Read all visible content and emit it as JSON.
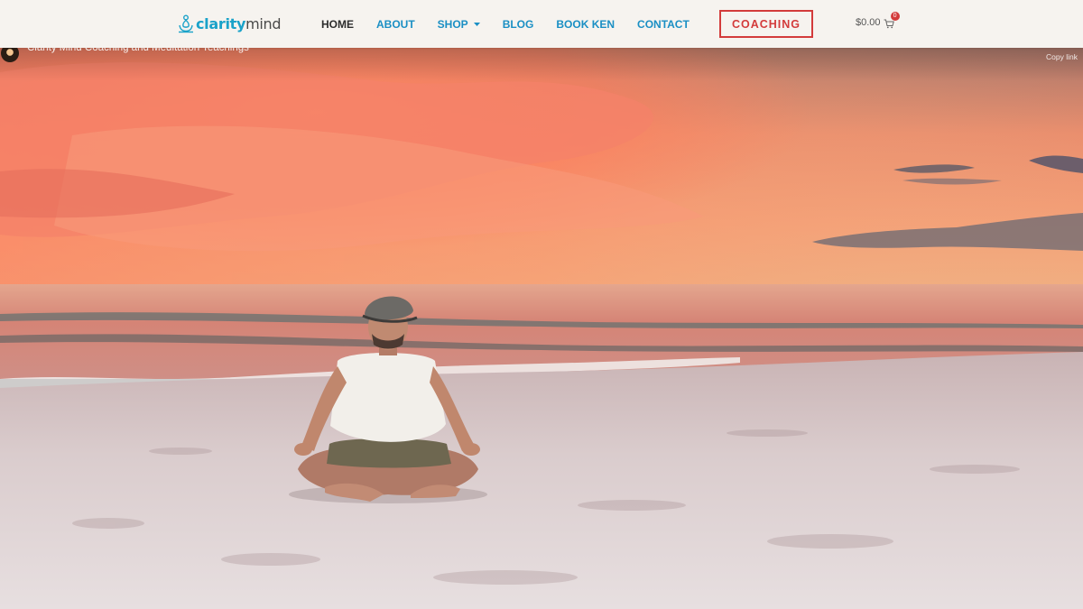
{
  "header": {
    "logo": {
      "word1": "clarity",
      "word2": "mind",
      "icon": "lotus-meditation-icon"
    },
    "nav": [
      {
        "label": "HOME",
        "active": true
      },
      {
        "label": "ABOUT",
        "active": false
      },
      {
        "label": "SHOP",
        "active": false,
        "has_dropdown": true
      },
      {
        "label": "BLOG",
        "active": false
      },
      {
        "label": "BOOK KEN",
        "active": false
      },
      {
        "label": "CONTACT",
        "active": false
      }
    ],
    "cta_label": "COACHING",
    "cart": {
      "total": "$0.00",
      "count": "0",
      "icon": "cart-icon"
    }
  },
  "video": {
    "title": "Clarity Mind Coaching and Meditation Teachings",
    "copy_link": "Copy link"
  },
  "colors": {
    "brand_blue": "#1a8fc4",
    "accent_red": "#d33b3b",
    "header_bg": "#f6f3ef",
    "nav_active": "#2c2c2c"
  }
}
